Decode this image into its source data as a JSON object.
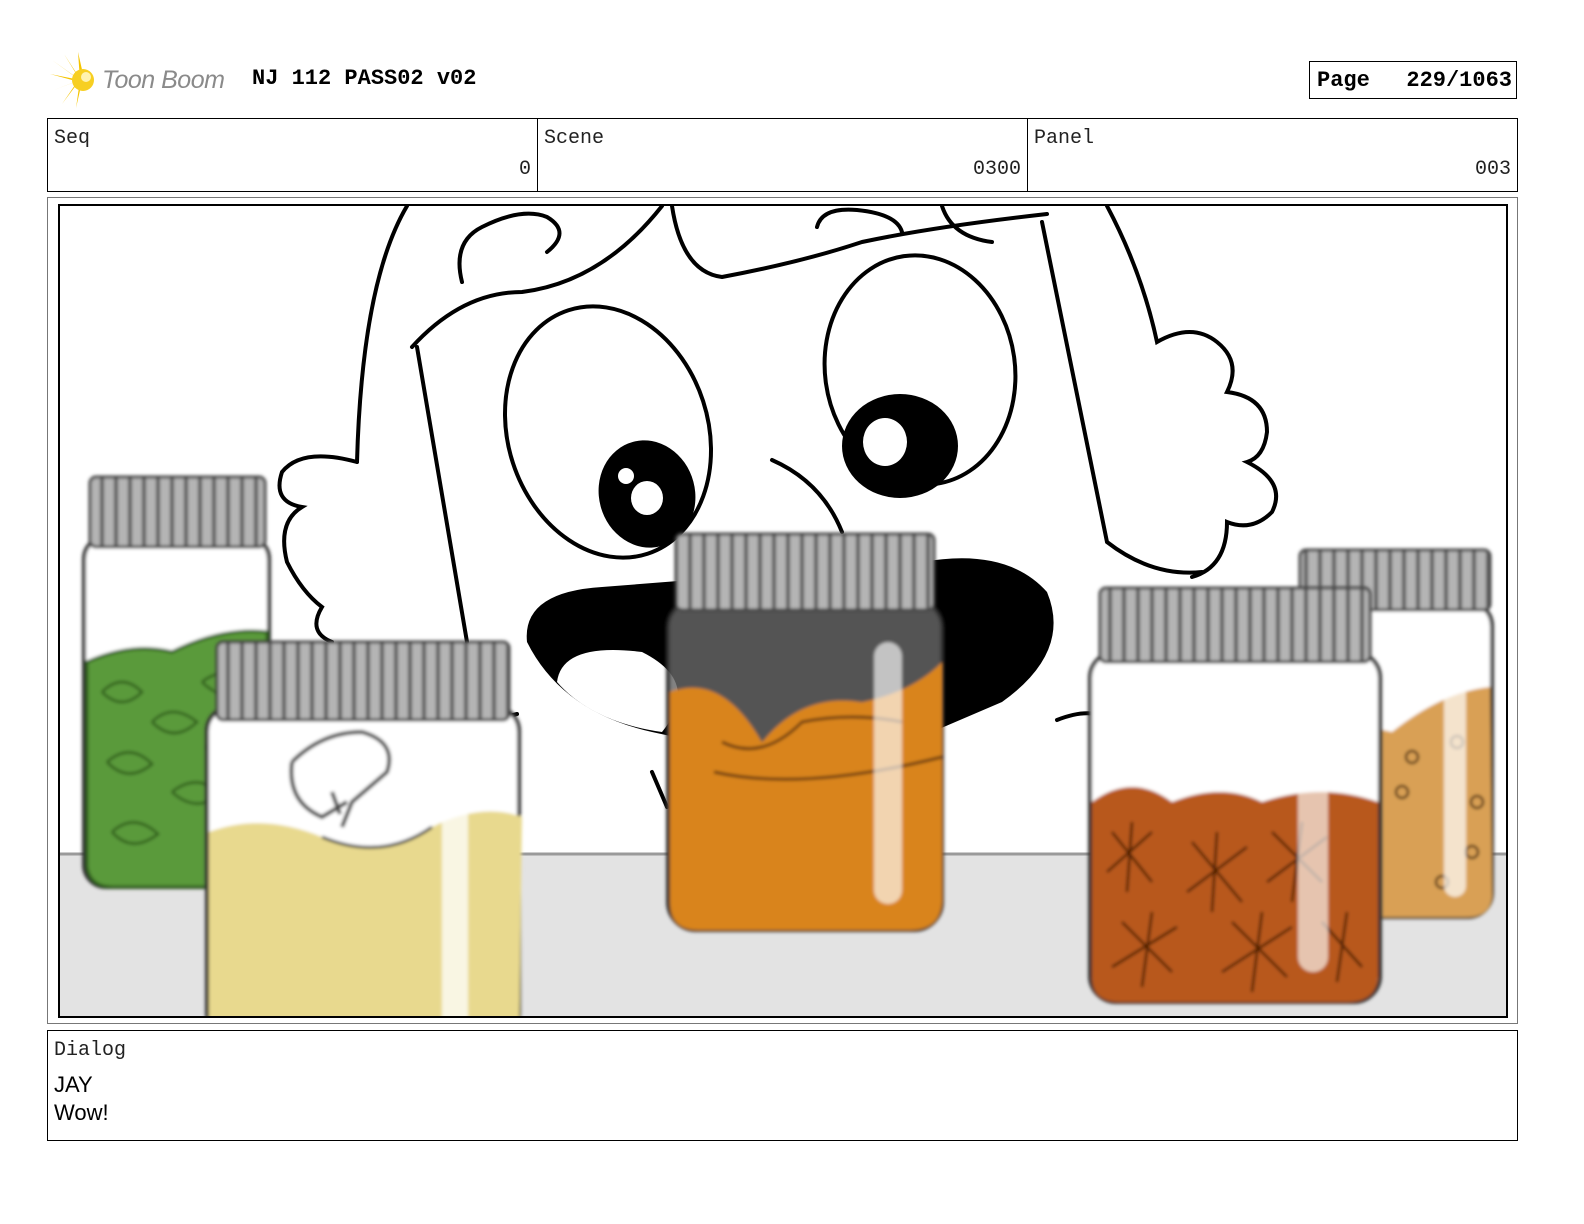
{
  "header": {
    "logo_text": "Toon Boom",
    "project_title": "NJ 112 PASS02 v02",
    "page_label": "Page",
    "page_value": "229/1063"
  },
  "fields": {
    "seq": {
      "label": "Seq",
      "value": "0"
    },
    "scene": {
      "label": "Scene",
      "value": "0300"
    },
    "panel": {
      "label": "Panel",
      "value": "003"
    }
  },
  "dialog": {
    "label": "Dialog",
    "speaker": "JAY",
    "line": "Wow!"
  },
  "icons": [
    "toon-boom-logo-icon"
  ],
  "colors": {
    "logo_yellow": "#f5c400",
    "jar_lid": "#9e9e9e",
    "jar_green": "#5a9a3a",
    "jar_cream": "#e8d98e",
    "jar_orange": "#d9841f",
    "jar_rust": "#b8581c",
    "jar_tan": "#d9a055",
    "table": "#e3e3e3"
  }
}
